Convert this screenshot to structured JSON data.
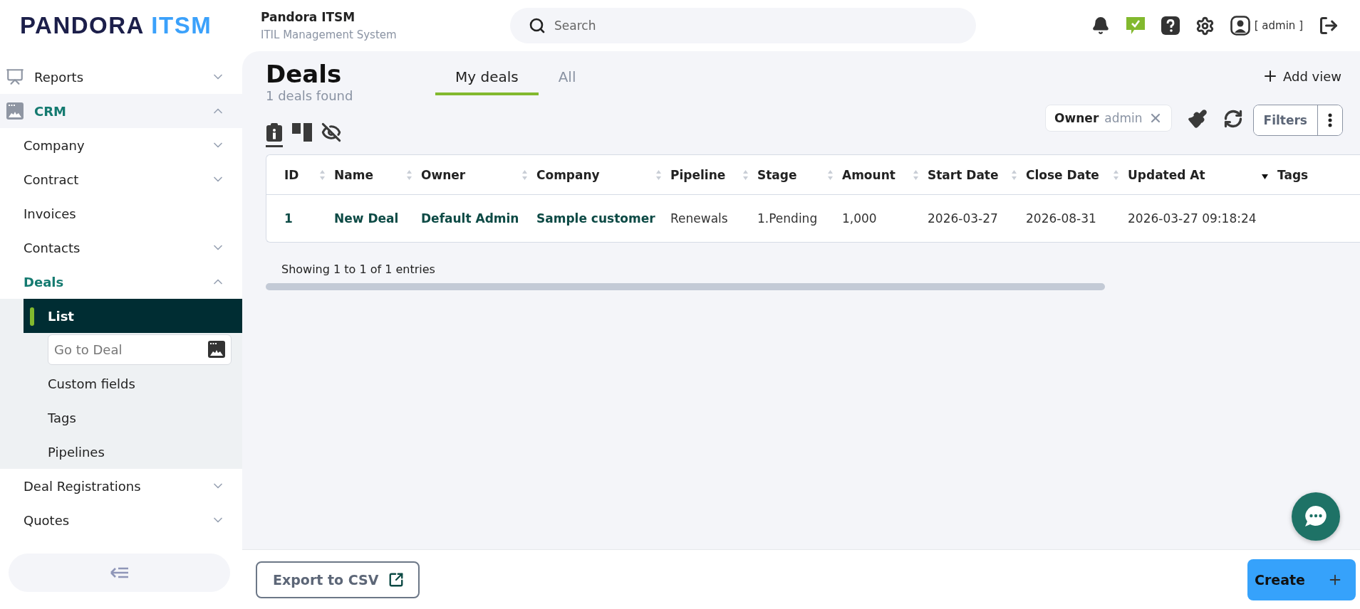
{
  "header": {
    "logo": {
      "name": "PANDORA",
      "accent": "ITSM"
    },
    "title": "Pandora ITSM",
    "subtitle": "ITIL Management System",
    "search": {
      "placeholder": "Search"
    },
    "user": "[ admin ]"
  },
  "sidebar": {
    "items": [
      {
        "label": "Reports",
        "expanded": false,
        "selected": false
      },
      {
        "label": "CRM",
        "expanded": true,
        "selected": true,
        "children": [
          {
            "label": "Company",
            "expanded": false,
            "selected": false
          },
          {
            "label": "Contract",
            "expanded": false,
            "selected": false
          },
          {
            "label": "Invoices",
            "selected": false
          },
          {
            "label": "Contacts",
            "expanded": false,
            "selected": false
          },
          {
            "label": "Deals",
            "expanded": true,
            "selected": true,
            "children": [
              {
                "kind": "link",
                "label": "List",
                "selected": true
              },
              {
                "kind": "field",
                "placeholder": "Go to Deal"
              },
              {
                "kind": "link",
                "label": "Custom fields",
                "selected": false
              },
              {
                "kind": "link",
                "label": "Tags",
                "selected": false
              },
              {
                "kind": "link",
                "label": "Pipelines",
                "selected": false
              }
            ]
          },
          {
            "label": "Deal Registrations",
            "expanded": false,
            "selected": false
          },
          {
            "label": "Quotes",
            "expanded": false,
            "selected": false
          }
        ]
      }
    ]
  },
  "page": {
    "title": "Deals",
    "count": "1 deals found",
    "tabs": [
      {
        "label": "My deals",
        "selected": true
      },
      {
        "label": "All",
        "selected": false
      }
    ],
    "add_view": "Add view",
    "view_modes": [
      {
        "kind": "info",
        "selected": true
      },
      {
        "kind": "columns",
        "selected": false
      },
      {
        "kind": "hidden",
        "selected": false
      }
    ],
    "filter_chip": {
      "field": "Owner",
      "value": "admin"
    },
    "filters_button": "Filters",
    "table": {
      "columns": [
        {
          "label": "ID",
          "sortable": true,
          "sorted": false
        },
        {
          "label": "Name",
          "sortable": true,
          "sorted": false
        },
        {
          "label": "Owner",
          "sortable": true,
          "sorted": false
        },
        {
          "label": "Company",
          "sortable": true,
          "sorted": false
        },
        {
          "label": "Pipeline",
          "sortable": true,
          "sorted": false
        },
        {
          "label": "Stage",
          "sortable": true,
          "sorted": false
        },
        {
          "label": "Amount",
          "sortable": true,
          "sorted": false
        },
        {
          "label": "Start Date",
          "sortable": true,
          "sorted": false
        },
        {
          "label": "Close Date",
          "sortable": true,
          "sorted": false
        },
        {
          "label": "Updated At",
          "sortable": true,
          "sorted": true
        },
        {
          "label": "Tags",
          "sortable": false,
          "sorted": false
        }
      ],
      "rows": [
        [
          {
            "text": "1",
            "link": true
          },
          {
            "text": "New Deal",
            "link": true
          },
          {
            "text": "Default Admin",
            "link": true
          },
          {
            "text": "Sample customer",
            "link": true
          },
          {
            "text": "Renewals",
            "link": false
          },
          {
            "text": "1.Pending",
            "link": false
          },
          {
            "text": "1,000",
            "link": false
          },
          {
            "text": "2026-03-27",
            "link": false
          },
          {
            "text": "2026-08-31",
            "link": false
          },
          {
            "text": "2026-03-27 09:18:24",
            "link": false
          }
        ]
      ]
    },
    "entries": "Showing 1 to 1 of 1 entries"
  },
  "footer": {
    "export": "Export to CSV",
    "create": "Create"
  }
}
